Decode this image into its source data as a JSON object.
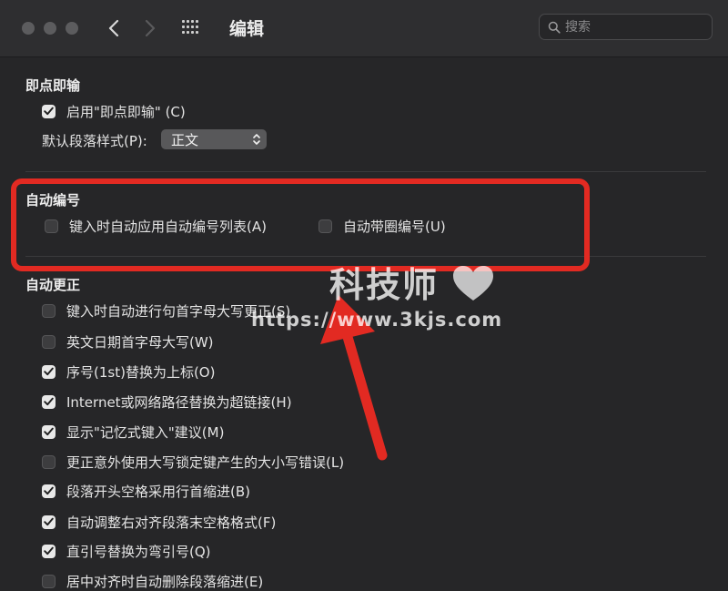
{
  "window": {
    "title": "编辑"
  },
  "search": {
    "placeholder": "搜索"
  },
  "section_instant": {
    "title": "即点即输",
    "enable_label": "启用\"即点即输\" (C)",
    "enable_checked": true,
    "default_style_label": "默认段落样式(P):",
    "default_style_value": "正文"
  },
  "section_autonumber": {
    "title": "自动编号",
    "items": [
      {
        "label": "键入时自动应用自动编号列表(A)",
        "checked": false
      },
      {
        "label": "自动带圈编号(U)",
        "checked": false
      }
    ]
  },
  "section_autocorrect": {
    "title": "自动更正",
    "items": [
      {
        "label": "键入时自动进行句首字母大写更正(S)",
        "checked": false
      },
      {
        "label": "英文日期首字母大写(W)",
        "checked": false
      },
      {
        "label": "序号(1st)替换为上标(O)",
        "checked": true
      },
      {
        "label": "Internet或网络路径替换为超链接(H)",
        "checked": true
      },
      {
        "label": "显示\"记忆式键入\"建议(M)",
        "checked": true
      },
      {
        "label": "更正意外使用大写锁定键产生的大小写错误(L)",
        "checked": false
      },
      {
        "label": "段落开头空格采用行首缩进(B)",
        "checked": true
      },
      {
        "label": "自动调整右对齐段落末空格格式(F)",
        "checked": true
      },
      {
        "label": "直引号替换为弯引号(Q)",
        "checked": true
      },
      {
        "label": "居中对齐时自动删除段落缩进(E)",
        "checked": false
      }
    ]
  },
  "watermark": {
    "title": "科技师",
    "url": "https://www.3kjs.com"
  },
  "colors": {
    "annotation_red": "#e22a22",
    "background": "#262628"
  }
}
